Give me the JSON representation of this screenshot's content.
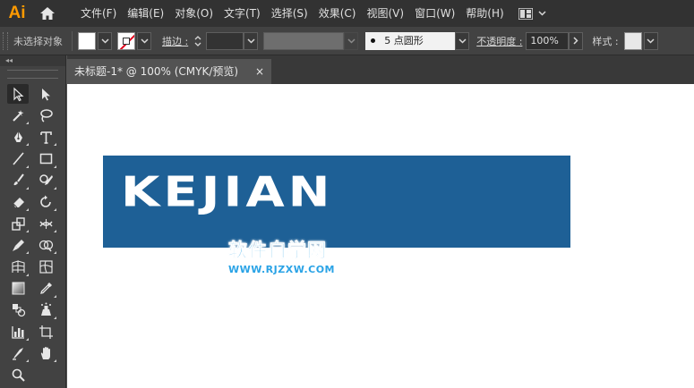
{
  "app": {
    "logo": "Ai",
    "accent": "#ff9a00"
  },
  "menu": {
    "items": [
      {
        "label": "文件(F)"
      },
      {
        "label": "编辑(E)"
      },
      {
        "label": "对象(O)"
      },
      {
        "label": "文字(T)"
      },
      {
        "label": "选择(S)"
      },
      {
        "label": "效果(C)"
      },
      {
        "label": "视图(V)"
      },
      {
        "label": "窗口(W)"
      },
      {
        "label": "帮助(H)"
      }
    ],
    "workspace_icon": "workspace-grid-icon"
  },
  "control_bar": {
    "selection_status": "未选择对象",
    "fill_color": "#ffffff",
    "stroke_color": "none",
    "stroke_label": "描边 :",
    "stroke_weight": "",
    "brush_value": "5 点圆形",
    "opacity_label": "不透明度 :",
    "opacity_value": "100%",
    "style_label": "样式 :"
  },
  "tools_panel": {
    "collapse_label": "◂◂",
    "tools": [
      "selection-tool",
      "direct-selection-tool",
      "magic-wand-tool",
      "lasso-tool",
      "pen-tool",
      "type-tool",
      "line-segment-tool",
      "rectangle-tool",
      "paintbrush-tool",
      "shaper-tool",
      "eraser-tool",
      "rotate-tool",
      "scale-tool",
      "width-tool",
      "puppet-warp-tool",
      "shape-builder-tool",
      "perspective-grid-tool",
      "mesh-tool",
      "gradient-tool",
      "eyedropper-tool",
      "blend-tool",
      "symbol-sprayer-tool",
      "column-graph-tool",
      "artboard-tool",
      "slice-tool",
      "hand-tool",
      "zoom-tool"
    ]
  },
  "document": {
    "tab_title": "未标题-1* @ 100% (CMYK/预览)",
    "close_glyph": "×"
  },
  "artwork": {
    "logo_text": "KEJIAN",
    "logo_bg": "#1e6096",
    "watermark_cn": "软件自学网",
    "watermark_url": "WWW.RJZXW.COM",
    "watermark_color": "#2aa3e6"
  }
}
